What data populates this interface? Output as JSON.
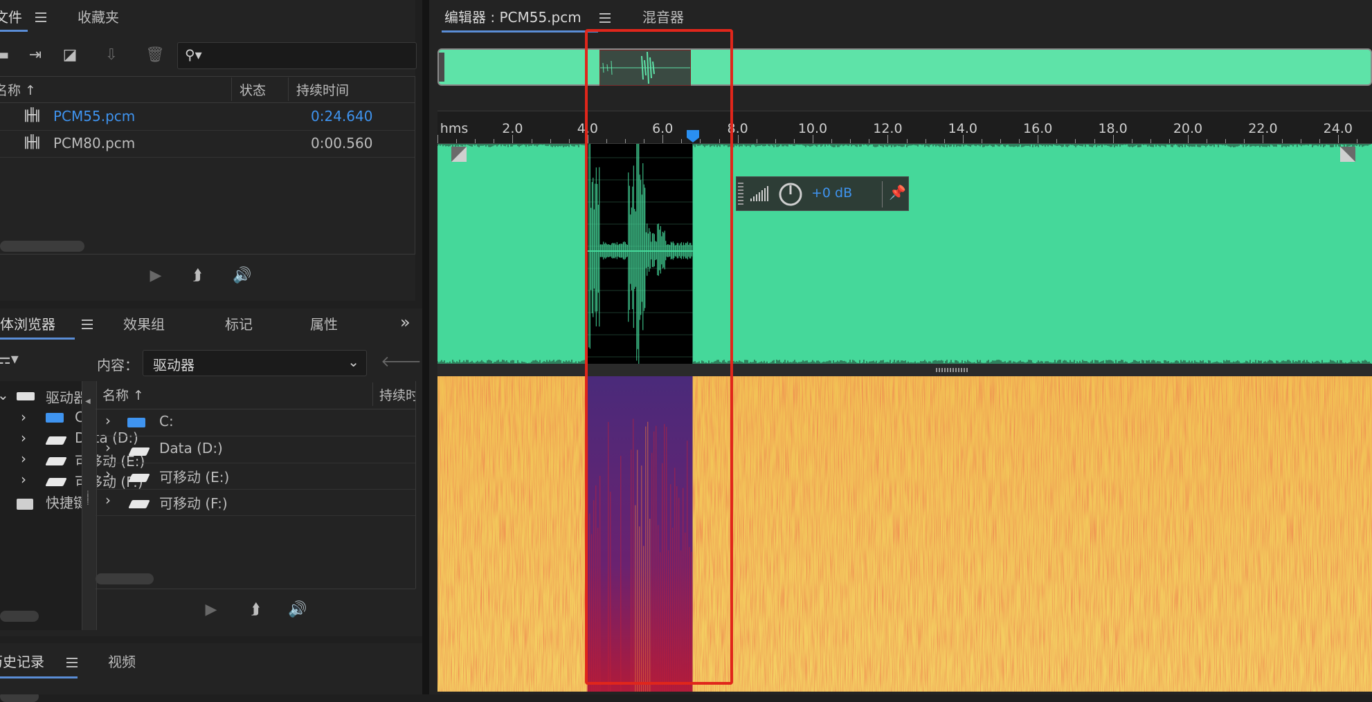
{
  "files_panel": {
    "tabs": [
      "文件",
      "收藏夹"
    ],
    "search_placeholder": "",
    "columns": {
      "name": "名称",
      "status": "状态",
      "duration": "持续时间"
    },
    "files": [
      {
        "name": "PCM55.pcm",
        "duration": "0:24.640",
        "selected": true
      },
      {
        "name": "PCM80.pcm",
        "duration": "0:00.560",
        "selected": false
      }
    ]
  },
  "media_panel": {
    "tabs": [
      "媒体浏览器",
      "效果组",
      "标记",
      "属性"
    ],
    "content_label": "内容：",
    "content_value": "驱动器",
    "tree": {
      "root": "驱动器",
      "items": [
        "C:",
        "Data (D:)",
        "可移动 (E:)",
        "可移动 (F:)"
      ],
      "shortcuts": "快捷键"
    },
    "columns": {
      "name": "名称",
      "duration": "持续时间"
    },
    "drives": [
      "C:",
      "Data (D:)",
      "可移动 (E:)",
      "可移动 (F:)"
    ]
  },
  "history_panel": {
    "tabs": [
      "历史记录",
      "视频"
    ]
  },
  "editor": {
    "tabs": [
      "编辑器 : PCM55.pcm",
      "混音器"
    ],
    "ruler_unit": "hms",
    "ruler_labels": [
      "2.0",
      "4.0",
      "6.0",
      "8.0",
      "10.0",
      "12.0",
      "14.0",
      "16.0",
      "18.0",
      "20.0",
      "22.0",
      "24.0"
    ],
    "total_duration_seconds": 24.64,
    "selection_seconds": [
      4.0,
      6.8
    ],
    "playhead_seconds": 6.8,
    "hud": {
      "volume": "+0 dB"
    },
    "colors": {
      "waveform_bg": "#45d89a",
      "waveform_selected_bg": "#000000",
      "spectrogram_hot": "#f0c050",
      "spectrogram_selected": "#5a2a7a",
      "highlight_box": "#e0261b",
      "accent": "#2a8ff0"
    }
  }
}
